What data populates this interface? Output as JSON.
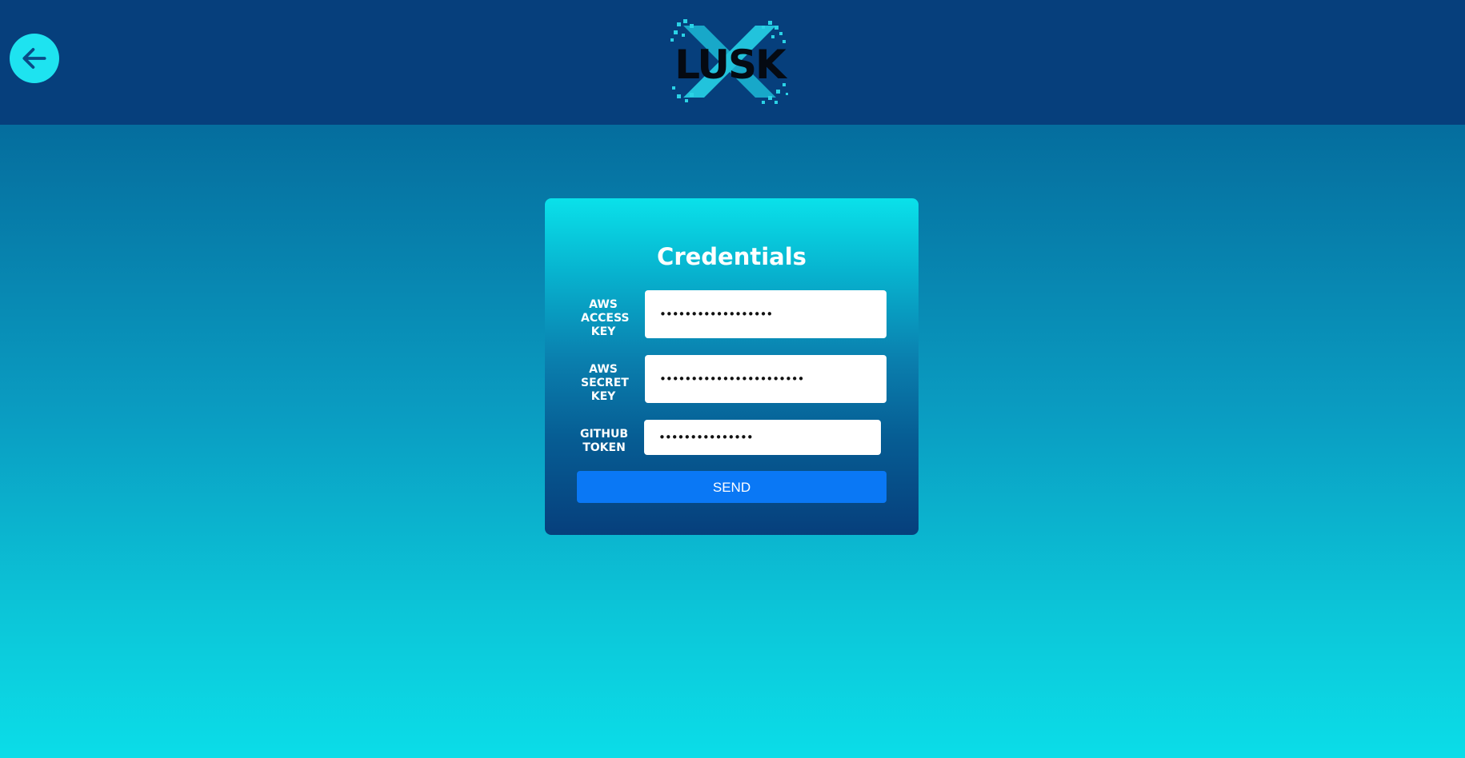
{
  "header": {
    "back_icon": "arrow-left-icon",
    "logo_text": "LUSK"
  },
  "form": {
    "title": "Credentials",
    "fields": [
      {
        "label": "AWS ACCESS KEY",
        "type": "password",
        "value": "••••••••••••••••••"
      },
      {
        "label": "AWS SECRET KEY",
        "type": "password",
        "value": "•••••••••••••••••••••••"
      },
      {
        "label": "GITHUB TOKEN",
        "type": "password",
        "value": "•••••••••••••••"
      }
    ],
    "submit_label": "SEND"
  },
  "colors": {
    "topbar": "#063f7c",
    "accent_cyan": "#1ee3f0",
    "button_blue": "#0a78f5"
  }
}
